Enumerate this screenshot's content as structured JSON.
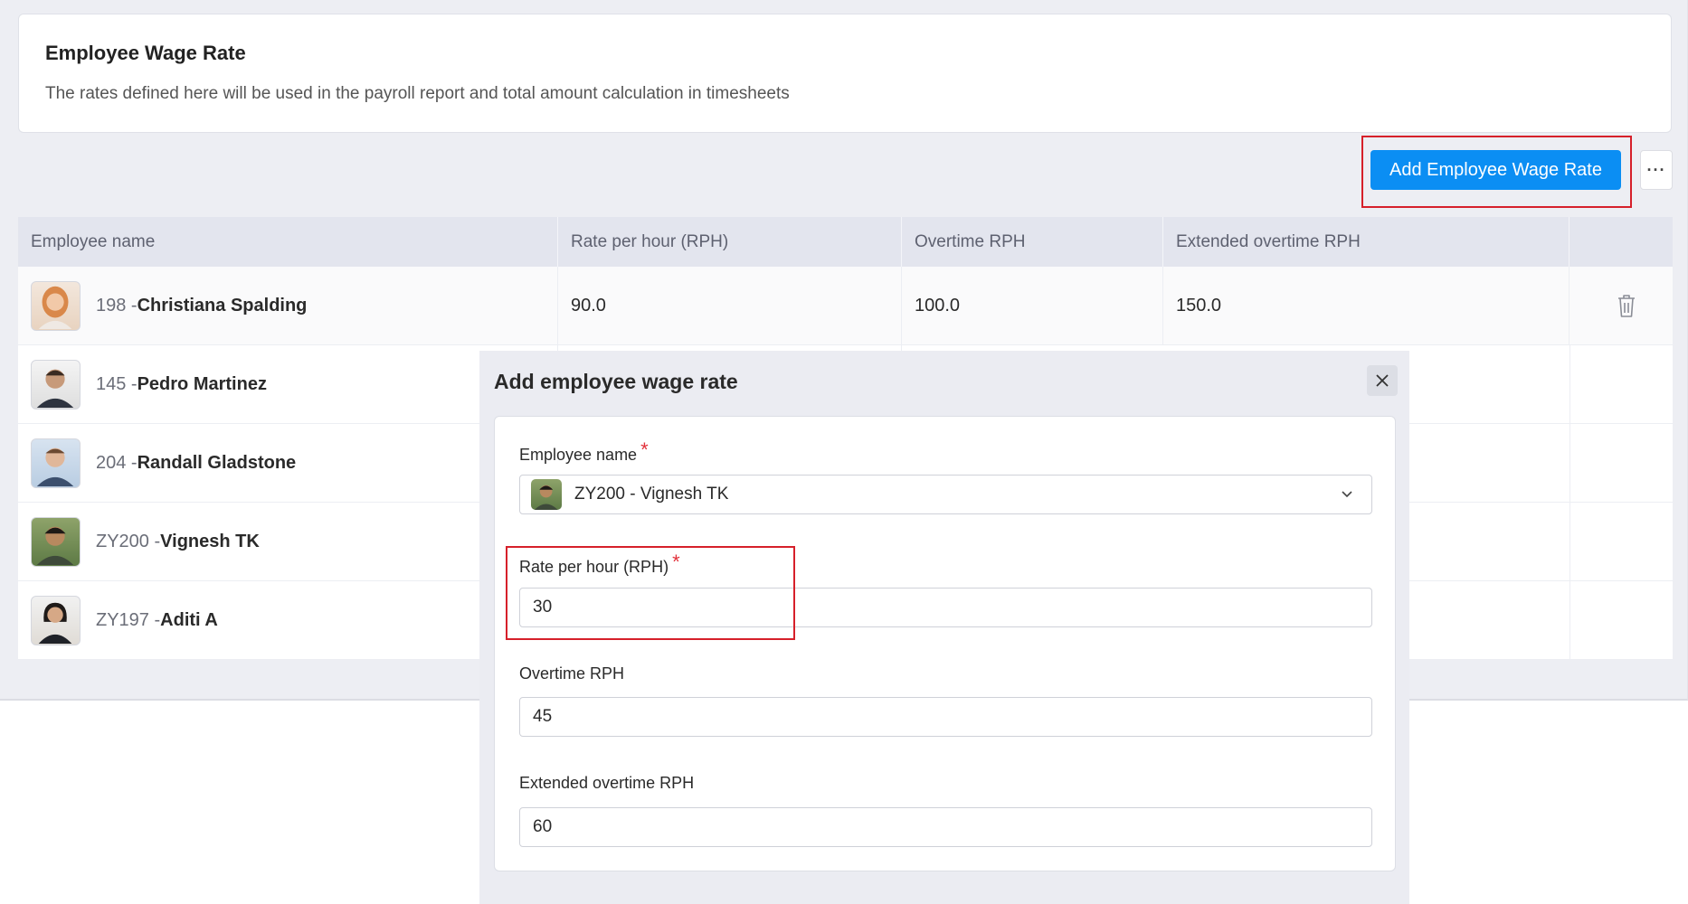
{
  "header": {
    "title": "Employee Wage Rate",
    "description": "The rates defined here will be used in the payroll report and total amount calculation in timesheets"
  },
  "toolbar": {
    "add_button_label": "Add Employee Wage Rate",
    "more_button_label": "···"
  },
  "table": {
    "columns": [
      "Employee name",
      "Rate per hour (RPH)",
      "Overtime RPH",
      "Extended overtime RPH"
    ],
    "rows": [
      {
        "id": "198 -",
        "name": "Christiana Spalding",
        "rph": "90.0",
        "overtime": "100.0",
        "extended": "150.0"
      },
      {
        "id": "145 -",
        "name": "Pedro Martinez"
      },
      {
        "id": "204 -",
        "name": "Randall Gladstone"
      },
      {
        "id": "ZY200 -",
        "name": "Vignesh TK"
      },
      {
        "id": "ZY197 -",
        "name": "Aditi A"
      }
    ]
  },
  "modal": {
    "title": "Add employee wage rate",
    "fields": {
      "employee_name_label": "Employee name",
      "employee_name_value": "ZY200 - Vignesh TK",
      "rph_label": "Rate per hour (RPH)",
      "rph_value": "30",
      "overtime_label": "Overtime RPH",
      "overtime_value": "45",
      "extended_label": "Extended overtime RPH",
      "extended_value": "60"
    },
    "required_marker": "*"
  },
  "colors": {
    "accent": "#0b8ef3",
    "highlight": "#d6202a",
    "required": "#e2323c"
  }
}
